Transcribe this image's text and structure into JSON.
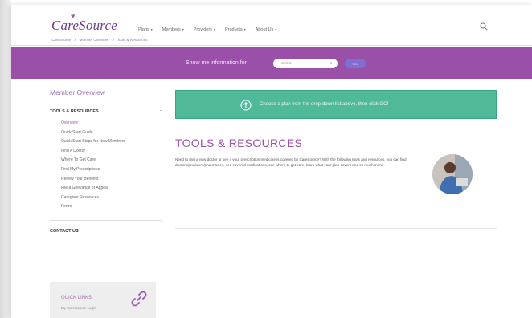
{
  "header": {
    "logo": "CareSource",
    "nav": [
      {
        "label": "Plans"
      },
      {
        "label": "Members"
      },
      {
        "label": "Providers"
      },
      {
        "label": "Products"
      },
      {
        "label": "About Us"
      }
    ],
    "breadcrumb": [
      "CareSource",
      ">",
      "Member Overview",
      ">",
      "Tools & Resources"
    ]
  },
  "plan_bar": {
    "label": "Show me information for",
    "select_value": "Select",
    "go_label": "GO"
  },
  "sidebar": {
    "title": "Member Overview",
    "section": "TOOLS & RESOURCES",
    "items": [
      {
        "label": "Overview"
      },
      {
        "label": "Quick Start Guide"
      },
      {
        "label": "Quick Start Steps for New Members"
      },
      {
        "label": "Find A Doctor"
      },
      {
        "label": "Where To Get Care"
      },
      {
        "label": "Find My Prescriptions"
      },
      {
        "label": "Renew Your Benefits"
      },
      {
        "label": "File a Grievance or Appeal"
      },
      {
        "label": "Caregiver Resources"
      },
      {
        "label": "Forms"
      }
    ],
    "contact": "CONTACT US",
    "quick_links": {
      "title": "QUICK LINKS",
      "link": "My CareSource Login"
    }
  },
  "main": {
    "banner_text": "Choose a plan from the drop-down list above, then click GO!",
    "title": "TOOLS & RESOURCES",
    "body": "Need to find a new doctor or see if your prescription medicine is covered by CareSource? With the following tools and resources, you can find doctors/providers/pharmacies, see covered medications, see where to get care, learn what your plan covers and so much more."
  },
  "colors": {
    "brand_purple": "#9a4fa8",
    "banner_green": "#4fb99a"
  }
}
